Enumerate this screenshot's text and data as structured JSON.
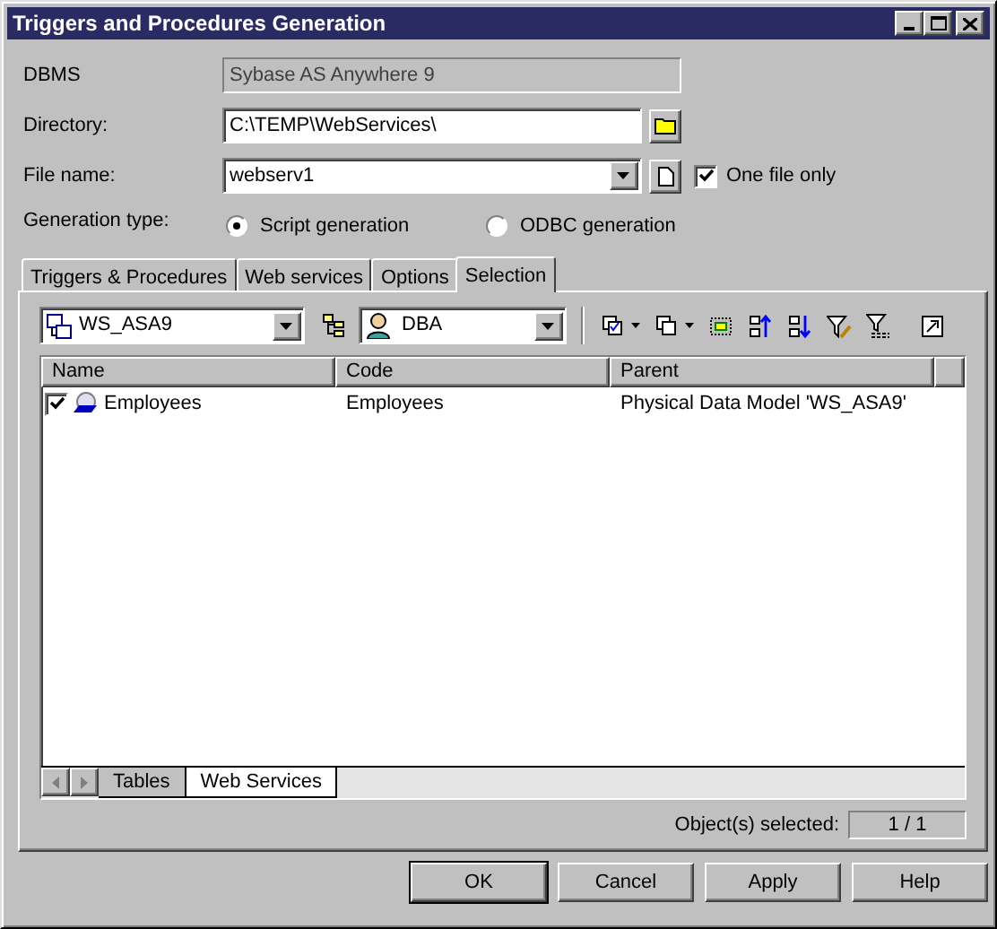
{
  "window": {
    "title": "Triggers and Procedures Generation"
  },
  "dbms": {
    "label": "DBMS",
    "value": "Sybase AS Anywhere 9"
  },
  "directory": {
    "label": "Directory:",
    "value": "C:\\TEMP\\WebServices\\"
  },
  "file_name": {
    "label": "File name:",
    "value": "webserv1"
  },
  "one_file_only": {
    "label": "One file only",
    "checked": true
  },
  "generation_type": {
    "label": "Generation type:",
    "options": [
      {
        "label": "Script generation",
        "selected": true
      },
      {
        "label": "ODBC generation",
        "selected": false
      }
    ]
  },
  "tabs": [
    {
      "label": "Triggers & Procedures",
      "selected": false
    },
    {
      "label": "Web services",
      "selected": false
    },
    {
      "label": "Options",
      "selected": false
    },
    {
      "label": "Selection",
      "selected": true
    }
  ],
  "selection": {
    "model": "WS_ASA9",
    "owner": "DBA",
    "columns": [
      "Name",
      "Code",
      "Parent"
    ],
    "rows": [
      {
        "checked": true,
        "name": "Employees",
        "code": "Employees",
        "parent": "Physical Data Model 'WS_ASA9'"
      }
    ],
    "sheet_tabs": [
      {
        "label": "Tables",
        "selected": false
      },
      {
        "label": "Web Services",
        "selected": true
      }
    ],
    "selected_label": "Object(s) selected:",
    "selected_count": "1 / 1"
  },
  "buttons": [
    "OK",
    "Cancel",
    "Apply",
    "Help"
  ]
}
